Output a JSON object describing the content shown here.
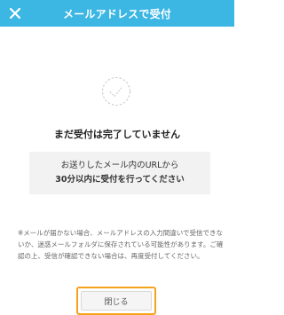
{
  "header": {
    "title": "メールアドレスで受付",
    "close_icon": "close-icon"
  },
  "main": {
    "status_icon": "check-circle-icon",
    "status_text": "まだ受付は完了していません",
    "info_line1": "お送りしたメール内のURLから",
    "info_line2": "30分以内に受付を行ってください",
    "notice": "※メールが届かない場合、メールアドレスの入力間違いで受信できないか、迷惑メールフォルダに保存されている可能性があります。ご確認の上、受信が確認できない場合は、再度受付してください。",
    "close_button_label": "閉じる"
  },
  "colors": {
    "header_bg": "#3cb6e3",
    "highlight": "#f7a21c"
  }
}
